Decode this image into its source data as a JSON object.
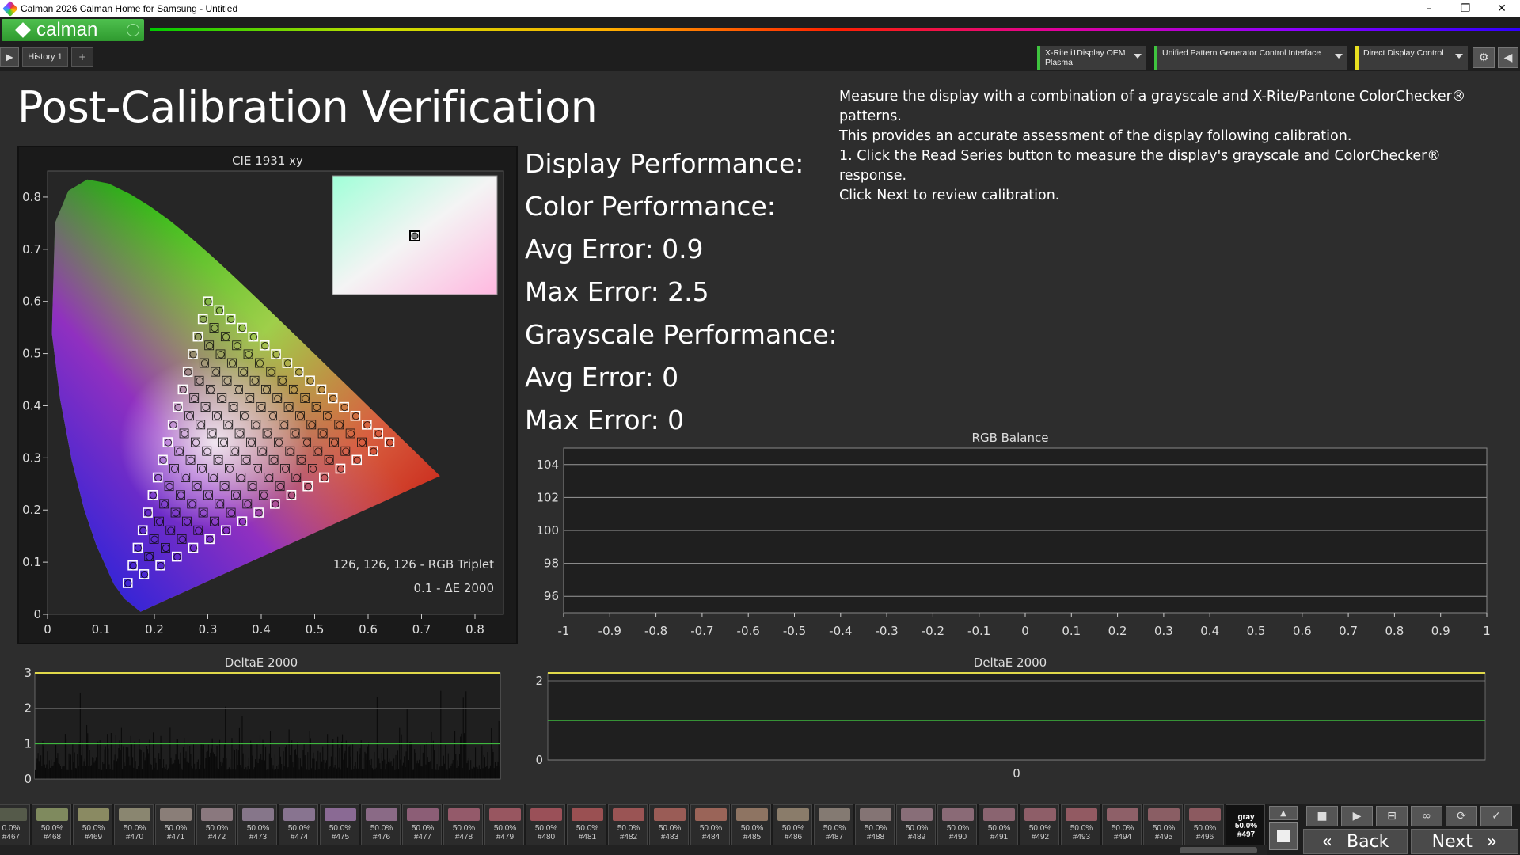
{
  "window": {
    "title": "Calman 2026 Calman Home for Samsung  - Untitled",
    "minimize": "–",
    "restore": "❐",
    "close": "✕"
  },
  "toolbar": {
    "logo_text": "calman"
  },
  "tabs": [
    {
      "label": "History 1"
    }
  ],
  "tab_add": "+",
  "devices": [
    {
      "label": "X-Rite i1Display OEM Plasma",
      "color": "#3fc43f"
    },
    {
      "label": "Unified Pattern Generator Control Interface",
      "color": "#3fc43f"
    },
    {
      "label": "Direct Display Control",
      "color": "#e8e020"
    }
  ],
  "page": {
    "title": "Post-Calibration Verification",
    "instructions": [
      "Measure the display with a combination of a grayscale and X-Rite/Pantone ColorChecker® patterns.",
      "This provides an accurate assessment of the display following calibration.",
      "1. Click the Read Series button to measure the display's grayscale and ColorChecker® response.",
      "Click Next to review calibration."
    ]
  },
  "performance": {
    "display": "Display Performance:",
    "color": "Color Performance:",
    "color_avg": "Avg Error: 0.9",
    "color_max": "Max Error: 2.5",
    "gray": "Grayscale Performance:",
    "gray_avg": "Avg Error: 0",
    "gray_max": "Max Error: 0"
  },
  "chart_data": [
    {
      "type": "scatter",
      "title": "CIE 1931 xy",
      "xlim": [
        0,
        0.8
      ],
      "ylim": [
        0,
        0.85
      ],
      "x_ticks": [
        "0",
        "0.1",
        "0.2",
        "0.3",
        "0.4",
        "0.5",
        "0.6",
        "0.7",
        "0.8"
      ],
      "y_ticks": [
        "0",
        "0.1",
        "0.2",
        "0.3",
        "0.4",
        "0.5",
        "0.6",
        "0.7",
        "0.8"
      ],
      "gamut_target_triangle": [
        [
          0.64,
          0.33
        ],
        [
          0.3,
          0.6
        ],
        [
          0.15,
          0.06
        ]
      ],
      "white_point": [
        0.3127,
        0.329
      ],
      "annotations": [
        "126, 126, 126 - RGB Triplet",
        "0.1 - ΔE 2000"
      ]
    },
    {
      "type": "line",
      "title": "RGB Balance",
      "xlim": [
        -1,
        1
      ],
      "ylim": [
        95,
        105
      ],
      "x_ticks": [
        "-1",
        "-0.9",
        "-0.8",
        "-0.7",
        "-0.6",
        "-0.5",
        "-0.4",
        "-0.3",
        "-0.2",
        "-0.1",
        "0",
        "0.1",
        "0.2",
        "0.3",
        "0.4",
        "0.5",
        "0.6",
        "0.7",
        "0.8",
        "0.9",
        "1"
      ],
      "y_ticks": [
        "96",
        "98",
        "100",
        "102",
        "104"
      ],
      "series": []
    },
    {
      "type": "bar",
      "title": "DeltaE 2000",
      "ylim": [
        0,
        3
      ],
      "y_ticks": [
        "0",
        "1",
        "2",
        "3"
      ],
      "reference_lines": [
        1,
        3
      ],
      "count": 497,
      "typical": 0.9,
      "max": 2.5
    },
    {
      "type": "bar",
      "title": "DeltaE 2000",
      "ylim": [
        0,
        2.2
      ],
      "y_ticks": [
        "0",
        "2"
      ],
      "x_ticks": [
        "0"
      ],
      "reference_lines": [
        1,
        2.2
      ],
      "values": [
        0
      ]
    }
  ],
  "swatches": [
    {
      "pct": "0.0%",
      "id": "#467",
      "color": "#555a4a"
    },
    {
      "pct": "50.0%",
      "id": "#468",
      "color": "#7f8a5e"
    },
    {
      "pct": "50.0%",
      "id": "#469",
      "color": "#8a8a62"
    },
    {
      "pct": "50.0%",
      "id": "#470",
      "color": "#8a8670"
    },
    {
      "pct": "50.0%",
      "id": "#471",
      "color": "#8a7e78"
    },
    {
      "pct": "50.0%",
      "id": "#472",
      "color": "#8a787e"
    },
    {
      "pct": "50.0%",
      "id": "#473",
      "color": "#86768a"
    },
    {
      "pct": "50.0%",
      "id": "#474",
      "color": "#887490"
    },
    {
      "pct": "50.0%",
      "id": "#475",
      "color": "#8a6a94"
    },
    {
      "pct": "50.0%",
      "id": "#476",
      "color": "#8a6a86"
    },
    {
      "pct": "50.0%",
      "id": "#477",
      "color": "#8c5e76"
    },
    {
      "pct": "50.0%",
      "id": "#478",
      "color": "#945a6a"
    },
    {
      "pct": "50.0%",
      "id": "#479",
      "color": "#985660"
    },
    {
      "pct": "50.0%",
      "id": "#480",
      "color": "#9a5058"
    },
    {
      "pct": "50.0%",
      "id": "#481",
      "color": "#9a5052"
    },
    {
      "pct": "50.0%",
      "id": "#482",
      "color": "#9a5454"
    },
    {
      "pct": "50.0%",
      "id": "#483",
      "color": "#9a5c56"
    },
    {
      "pct": "50.0%",
      "id": "#484",
      "color": "#9a6458"
    },
    {
      "pct": "50.0%",
      "id": "#485",
      "color": "#8e7462"
    },
    {
      "pct": "50.0%",
      "id": "#486",
      "color": "#8a7c6a"
    },
    {
      "pct": "50.0%",
      "id": "#487",
      "color": "#847a72"
    },
    {
      "pct": "50.0%",
      "id": "#488",
      "color": "#847474"
    },
    {
      "pct": "50.0%",
      "id": "#489",
      "color": "#886e78"
    },
    {
      "pct": "50.0%",
      "id": "#490",
      "color": "#8a6a76"
    },
    {
      "pct": "50.0%",
      "id": "#491",
      "color": "#8a6470"
    },
    {
      "pct": "50.0%",
      "id": "#492",
      "color": "#8e5e68"
    },
    {
      "pct": "50.0%",
      "id": "#493",
      "color": "#925a62"
    },
    {
      "pct": "50.0%",
      "id": "#494",
      "color": "#8e6068"
    },
    {
      "pct": "50.0%",
      "id": "#495",
      "color": "#8a5e64"
    },
    {
      "pct": "50.0%",
      "id": "#496",
      "color": "#8c5a60"
    }
  ],
  "active_swatch": {
    "name": "gray",
    "pct": "50.0%",
    "id": "#497"
  },
  "nav": {
    "back": "Back",
    "next": "Next"
  }
}
